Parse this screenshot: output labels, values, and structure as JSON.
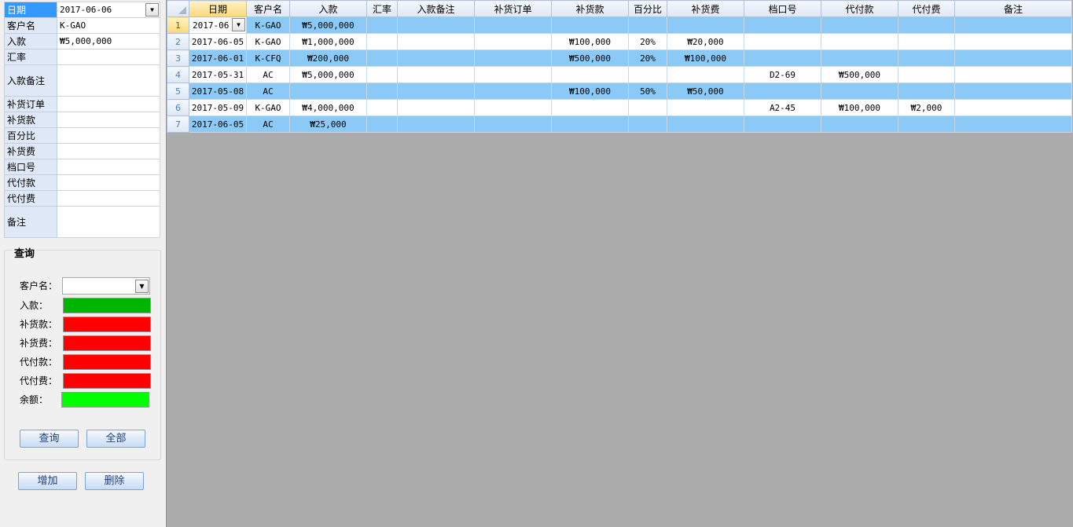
{
  "detail": {
    "rows": [
      {
        "label": "日期",
        "value": "2017-06-06"
      },
      {
        "label": "客户名",
        "value": "K-GAO"
      },
      {
        "label": "入款",
        "value": "₩5,000,000"
      },
      {
        "label": "汇率",
        "value": ""
      },
      {
        "label": "入款备注",
        "value": ""
      },
      {
        "label": "补货订单",
        "value": ""
      },
      {
        "label": "补货款",
        "value": ""
      },
      {
        "label": "百分比",
        "value": ""
      },
      {
        "label": "补货费",
        "value": ""
      },
      {
        "label": "档口号",
        "value": ""
      },
      {
        "label": "代付款",
        "value": ""
      },
      {
        "label": "代付费",
        "value": ""
      },
      {
        "label": "备注",
        "value": ""
      }
    ]
  },
  "query": {
    "title": "查询",
    "customer_label": "客户名：",
    "customer_value": "",
    "deposit_label": "入款：",
    "restock_amount_label": "补货款：",
    "restock_fee_label": "补货费：",
    "proxy_amount_label": "代付款：",
    "proxy_fee_label": "代付费：",
    "balance_label": "余额：",
    "deposit_color": "#00b400",
    "restock_amount_color": "#ff0000",
    "restock_fee_color": "#ff0000",
    "proxy_amount_color": "#ff0000",
    "proxy_fee_color": "#ff0000",
    "balance_color": "#00ff00",
    "search_button": "查询",
    "all_button": "全部"
  },
  "actions": {
    "add_button": "增加",
    "delete_button": "删除"
  },
  "grid": {
    "columns": [
      "日期",
      "客户名",
      "入款",
      "汇率",
      "入款备注",
      "补货订单",
      "补货款",
      "百分比",
      "补货费",
      "档口号",
      "代付款",
      "代付费",
      "备注"
    ],
    "rows": [
      {
        "num": "1",
        "date": "2017-06",
        "customer": "K-GAO",
        "deposit": "₩5,000,000",
        "rate": "",
        "deposit_note": "",
        "restock_order": "",
        "restock_amount": "",
        "percent": "",
        "restock_fee": "",
        "stall": "",
        "proxy_amount": "",
        "proxy_fee": "",
        "note": ""
      },
      {
        "num": "2",
        "date": "2017-06-05",
        "customer": "K-GAO",
        "deposit": "₩1,000,000",
        "rate": "",
        "deposit_note": "",
        "restock_order": "",
        "restock_amount": "₩100,000",
        "percent": "20%",
        "restock_fee": "₩20,000",
        "stall": "",
        "proxy_amount": "",
        "proxy_fee": "",
        "note": ""
      },
      {
        "num": "3",
        "date": "2017-06-01",
        "customer": "K-CFQ",
        "deposit": "₩200,000",
        "rate": "",
        "deposit_note": "",
        "restock_order": "",
        "restock_amount": "₩500,000",
        "percent": "20%",
        "restock_fee": "₩100,000",
        "stall": "",
        "proxy_amount": "",
        "proxy_fee": "",
        "note": ""
      },
      {
        "num": "4",
        "date": "2017-05-31",
        "customer": "AC",
        "deposit": "₩5,000,000",
        "rate": "",
        "deposit_note": "",
        "restock_order": "",
        "restock_amount": "",
        "percent": "",
        "restock_fee": "",
        "stall": "D2-69",
        "proxy_amount": "₩500,000",
        "proxy_fee": "",
        "note": ""
      },
      {
        "num": "5",
        "date": "2017-05-08",
        "customer": "AC",
        "deposit": "",
        "rate": "",
        "deposit_note": "",
        "restock_order": "",
        "restock_amount": "₩100,000",
        "percent": "50%",
        "restock_fee": "₩50,000",
        "stall": "",
        "proxy_amount": "",
        "proxy_fee": "",
        "note": ""
      },
      {
        "num": "6",
        "date": "2017-05-09",
        "customer": "K-GAO",
        "deposit": "₩4,000,000",
        "rate": "",
        "deposit_note": "",
        "restock_order": "",
        "restock_amount": "",
        "percent": "",
        "restock_fee": "",
        "stall": "A2-45",
        "proxy_amount": "₩100,000",
        "proxy_fee": "₩2,000",
        "note": ""
      },
      {
        "num": "7",
        "date": "2017-06-05",
        "customer": "AC",
        "deposit": "₩25,000",
        "rate": "",
        "deposit_note": "",
        "restock_order": "",
        "restock_amount": "",
        "percent": "",
        "restock_fee": "",
        "stall": "",
        "proxy_amount": "",
        "proxy_fee": "",
        "note": ""
      }
    ]
  }
}
